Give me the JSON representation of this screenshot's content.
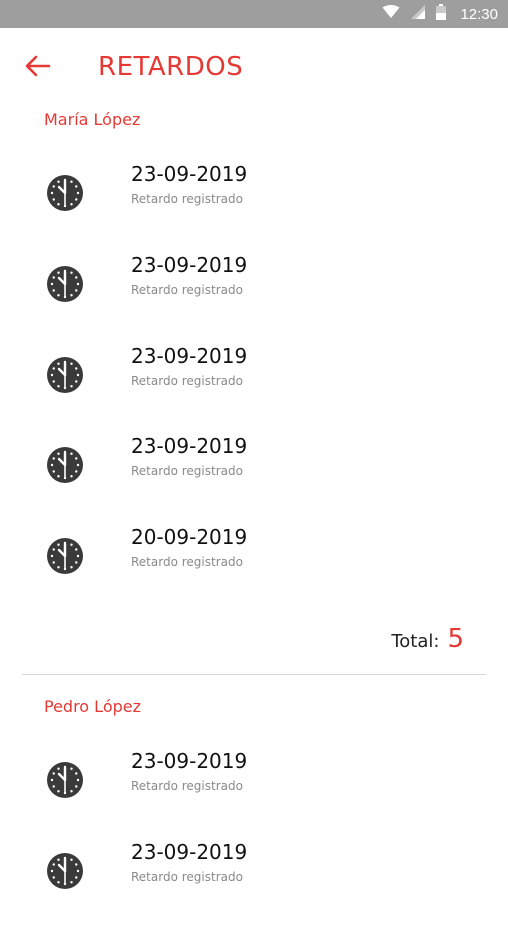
{
  "status_bar": {
    "time": "12:30",
    "icons": [
      "wifi-icon",
      "signal-icon",
      "battery-icon"
    ]
  },
  "app_bar": {
    "back_icon": "arrow-left-icon",
    "title": "RETARDOS"
  },
  "colors": {
    "accent": "#e53935",
    "status_bar": "#9e9e9e",
    "clock_icon": "#3a3a3a"
  },
  "sections": [
    {
      "name": "María López",
      "entries": [
        {
          "date": "23-09-2019",
          "status": "Retardo registrado",
          "icon": "clock-icon"
        },
        {
          "date": "23-09-2019",
          "status": "Retardo registrado",
          "icon": "clock-icon"
        },
        {
          "date": "23-09-2019",
          "status": "Retardo registrado",
          "icon": "clock-icon"
        },
        {
          "date": "23-09-2019",
          "status": "Retardo registrado",
          "icon": "clock-icon"
        },
        {
          "date": "20-09-2019",
          "status": "Retardo registrado",
          "icon": "clock-icon"
        }
      ],
      "total_label": "Total:",
      "total_value": "5"
    },
    {
      "name": "Pedro López",
      "entries": [
        {
          "date": "23-09-2019",
          "status": "Retardo registrado",
          "icon": "clock-icon"
        },
        {
          "date": "23-09-2019",
          "status": "Retardo registrado",
          "icon": "clock-icon"
        }
      ]
    }
  ]
}
